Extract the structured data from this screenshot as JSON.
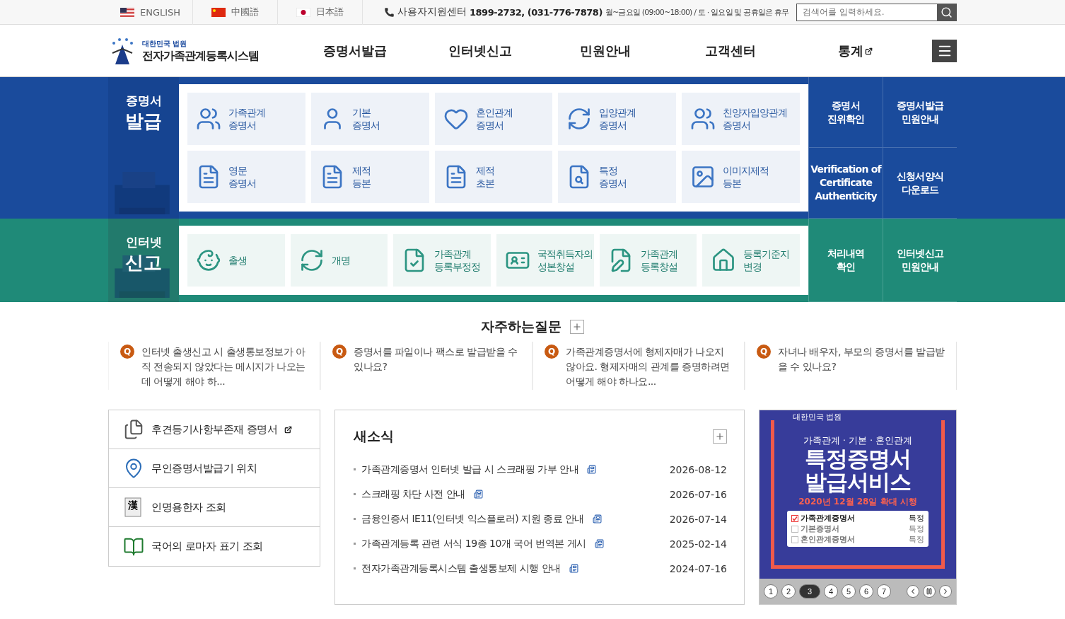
{
  "top_bar": {
    "languages": [
      {
        "label": "ENGLISH"
      },
      {
        "label": "中國語"
      },
      {
        "label": "日本語"
      }
    ],
    "helpdesk": {
      "label": "사용자지원센터",
      "phones": "1899-2732, (031-776-7878)",
      "hours": "월~금요일 (09:00~18:00) / 토 · 일요일 및 공휴일은 휴무"
    },
    "search": {
      "placeholder": "검색어를 입력하세요."
    }
  },
  "header": {
    "logo_small": "대한민국 법원",
    "logo_title": "전자가족관계등록시스템",
    "nav": [
      {
        "label": "증명서발급",
        "external": false
      },
      {
        "label": "인터넷신고",
        "external": false
      },
      {
        "label": "민원안내",
        "external": false
      },
      {
        "label": "고객센터",
        "external": false
      },
      {
        "label": "통계",
        "external": true
      }
    ]
  },
  "sections": [
    {
      "kind": "issue",
      "title_top": "증명서",
      "title_main": "발급",
      "tiles": [
        {
          "line1": "가족관계",
          "line2": "증명서"
        },
        {
          "line1": "기본",
          "line2": "증명서"
        },
        {
          "line1": "혼인관계",
          "line2": "증명서"
        },
        {
          "line1": "입양관계",
          "line2": "증명서"
        },
        {
          "line1": "친양자입양관계",
          "line2": "증명서"
        },
        {
          "line1": "영문",
          "line2": "증명서"
        },
        {
          "line1": "제적",
          "line2": "등본"
        },
        {
          "line1": "제적",
          "line2": "초본"
        },
        {
          "line1": "특정",
          "line2": "증명서"
        },
        {
          "line1": "이미지제적",
          "line2": "등본"
        }
      ],
      "links": [
        {
          "lines": [
            "증명서",
            "진위확인"
          ]
        },
        {
          "lines": [
            "증명서발급",
            "민원안내"
          ]
        },
        {
          "lines": [
            "Verification of",
            "Certificate",
            "Authenticity"
          ]
        },
        {
          "lines": [
            "신청서양식",
            "다운로드"
          ]
        }
      ]
    },
    {
      "kind": "report",
      "title_top": "인터넷",
      "title_main": "신고",
      "tiles": [
        {
          "line1": "출생"
        },
        {
          "line1": "개명"
        },
        {
          "line1": "가족관계",
          "line2": "등록부정정"
        },
        {
          "line1": "국적취득자의",
          "line2": "성본창설"
        },
        {
          "line1": "가족관계",
          "line2": "등록창설"
        },
        {
          "line1": "등록기준지",
          "line2": "변경"
        }
      ],
      "links": [
        {
          "lines": [
            "처리내역",
            "확인"
          ]
        },
        {
          "lines": [
            "인터넷신고",
            "민원안내"
          ]
        }
      ]
    }
  ],
  "faq": {
    "title": "자주하는질문",
    "items": [
      {
        "badge": "Q",
        "text": "인터넷 출생신고 시 출생통보정보가 아직 전송되지 않았다는 메시지가 나오는데 어떻게 해야 하..."
      },
      {
        "badge": "Q",
        "text": "증명서를 파일이나 팩스로 발급받을 수 있나요?"
      },
      {
        "badge": "Q",
        "text": "가족관계증명서에 형제자매가 나오지 않아요. 형제자매의 관계를 증명하려면 어떻게 해야 하나요..."
      },
      {
        "badge": "Q",
        "text": "자녀나 배우자, 부모의 증명서를 발급받을 수 있나요?"
      }
    ]
  },
  "quick_links": [
    {
      "label": "후견등기사항부존재 증명서",
      "external": true
    },
    {
      "label": "무인증명서발급기 위치",
      "external": false
    },
    {
      "label": "인명용한자 조회",
      "hanja": "漢",
      "external": false
    },
    {
      "label": "국어의 로마자 표기 조회",
      "external": false
    }
  ],
  "news": {
    "title": "새소식",
    "items": [
      {
        "title": "가족관계증명서 인터넷 발급 시 스크래핑 가부 안내",
        "date": "2026-08-12"
      },
      {
        "title": "스크래핑 차단 사전 안내",
        "date": "2026-07-16"
      },
      {
        "title": "금융인증서 IE11(인터넷 익스플로러) 지원 종료 안내",
        "date": "2026-07-14"
      },
      {
        "title": "가족관계등록 관련 서식 19종 10개 국어 번역본 게시",
        "date": "2025-02-14"
      },
      {
        "title": "전자가족관계등록시스템 출생통보제 시행 안내",
        "date": "2024-07-16"
      }
    ]
  },
  "banner": {
    "brand": "대한민국 법원",
    "subtitle": "가족관계 · 기본 · 혼인관계",
    "headline1": "특정증명서",
    "headline2": "발급서비스",
    "date": "2020년 12월 28일 확대 시행",
    "options": [
      {
        "label": "가족관계증명서",
        "checked": true,
        "mark": "특정"
      },
      {
        "label": "기본증명서",
        "checked": false,
        "mark": "특정"
      },
      {
        "label": "혼인관계증명서",
        "checked": false,
        "mark": "특정"
      }
    ],
    "pages": [
      {
        "label": "1",
        "selected": false
      },
      {
        "label": "2",
        "selected": false
      },
      {
        "label": "3",
        "selected": true
      },
      {
        "label": "4",
        "selected": false
      },
      {
        "label": "5",
        "selected": false
      },
      {
        "label": "6",
        "selected": false
      },
      {
        "label": "7",
        "selected": false
      }
    ]
  }
}
